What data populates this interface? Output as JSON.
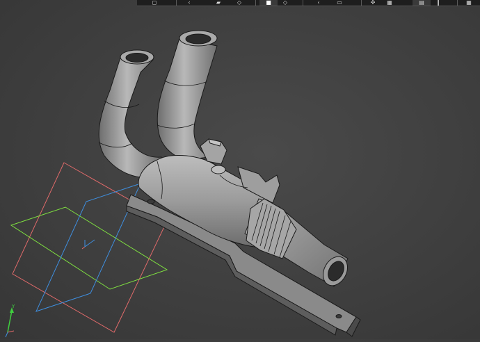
{
  "toolbar": {
    "buttons": [
      {
        "icon": "fit-view-icon"
      },
      {
        "icon": "rotate-left-icon"
      },
      {
        "icon": "shaded-view-icon"
      },
      {
        "icon": "section-view-icon"
      },
      {
        "icon": "solid-cube-icon"
      },
      {
        "icon": "wireframe-cube-icon"
      },
      {
        "icon": "perspective-icon"
      },
      {
        "icon": "view-options-icon"
      },
      {
        "icon": "explode-icon"
      },
      {
        "icon": "grid-toggle-icon"
      },
      {
        "icon": "display-mode-icon"
      },
      {
        "icon": "measure-icon"
      },
      {
        "icon": "settings-grid-icon"
      }
    ]
  },
  "triad": {
    "y_label": "Y",
    "y_color": "#3fcf3f"
  },
  "origin_planes": {
    "front_color": "#e06a6a",
    "top_color": "#7fe040",
    "right_color": "#3f8fe0"
  },
  "model": {
    "name": "pipe-assembly",
    "body_color": "#9a9a9a"
  }
}
